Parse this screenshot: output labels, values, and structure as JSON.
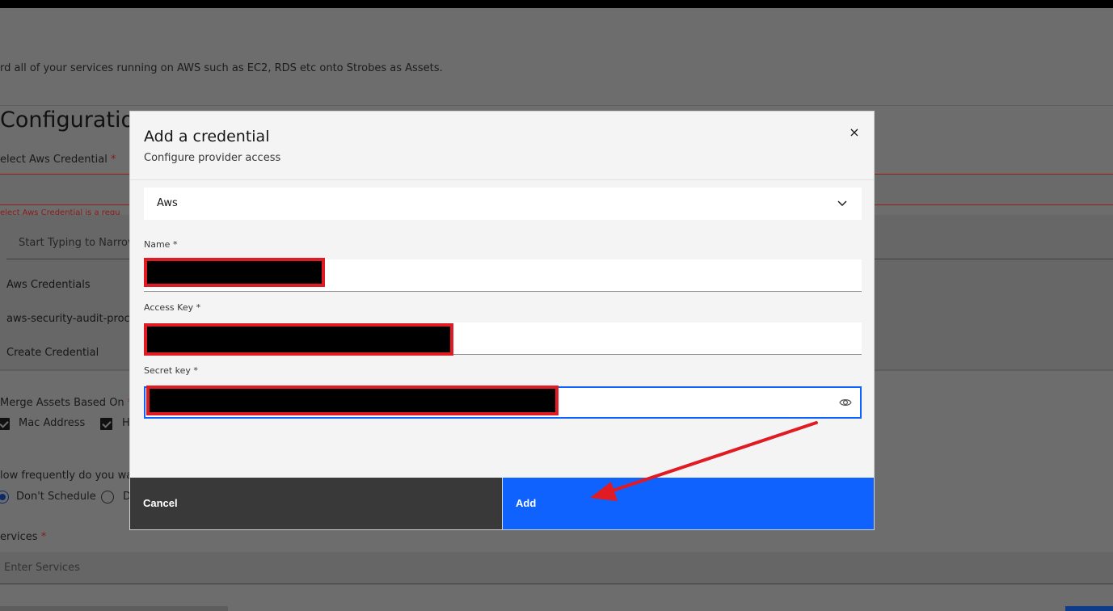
{
  "background": {
    "description": "rd all of your services running on AWS such as EC2, RDS etc onto Strobes as Assets.",
    "config_title": "Configuration",
    "credential_label": "elect Aws Credential",
    "required_mark": "*",
    "credential_error": "elect Aws Credential is a requ",
    "search_placeholder": "Start Typing to Narrov",
    "dropdown_items": [
      "Aws Credentials",
      "aws-security-audit-proc",
      "Create Credential"
    ],
    "merge_label": "Merge Assets Based On",
    "merge_options": [
      "Mac Address",
      "H"
    ],
    "schedule_label": "low frequently do you wa",
    "schedule_options": [
      "Don't Schedule",
      "D"
    ],
    "services_label": "ervices",
    "services_placeholder": "Enter Services"
  },
  "modal": {
    "title": "Add a credential",
    "subtitle": "Configure provider access",
    "close_symbol": "×",
    "provider": {
      "selected": "Aws"
    },
    "fields": {
      "name": {
        "label": "Name *"
      },
      "access_key": {
        "label": "Access Key *"
      },
      "secret_key": {
        "label": "Secret key *"
      }
    },
    "cancel_label": "Cancel",
    "add_label": "Add"
  },
  "colors": {
    "primary": "#0f62fe",
    "cancel_bg": "#393939",
    "annotation_red": "#e01b24",
    "error_red": "#da1e28"
  },
  "icons": {
    "close": "close-icon",
    "dropdown": "chevron-down-icon",
    "password_toggle": "eye-icon"
  }
}
